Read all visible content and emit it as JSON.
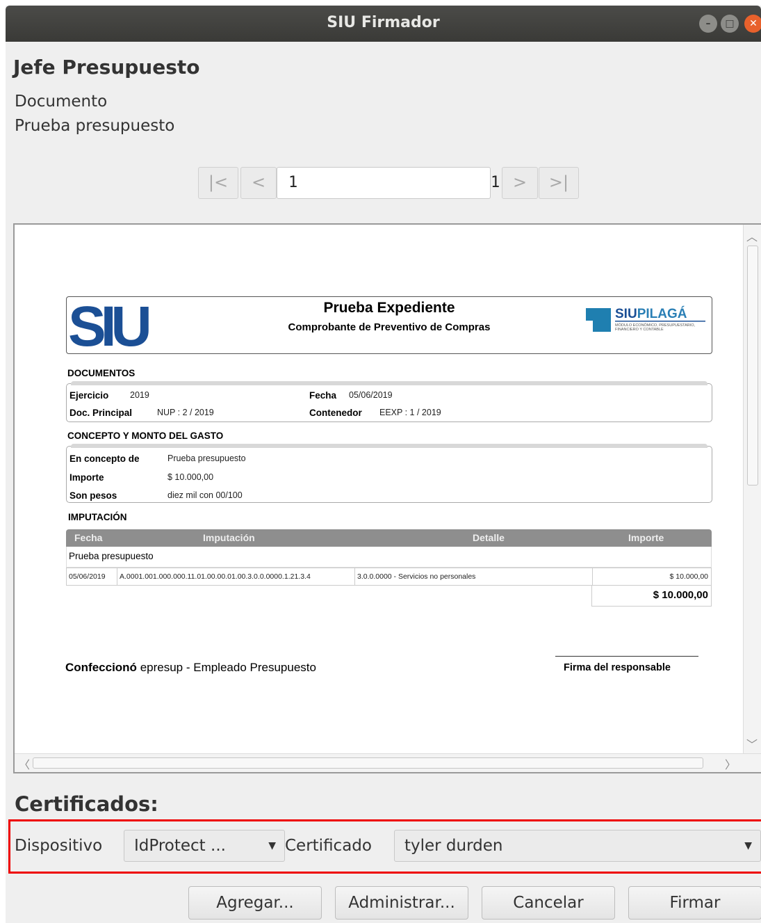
{
  "window": {
    "title": "SIU Firmador",
    "controls": {
      "minimize": "–",
      "maximize": "□",
      "close": "✕"
    }
  },
  "header": {
    "heading": "Jefe Presupuesto",
    "doc_label": "Documento",
    "doc_name": "Prueba presupuesto"
  },
  "pager": {
    "first": "|<",
    "prev": "<",
    "next": ">",
    "last": ">|",
    "current": "1",
    "total": "1"
  },
  "viewer": {
    "scroll_icons": {
      "up": "︿",
      "down": "﹀",
      "left": "〈",
      "right": "〉"
    },
    "logo_left": "SIU",
    "logo_right": {
      "brand_a": "SIU",
      "brand_b": "PILAGÁ",
      "tagline_1": "MÓDULO ECONÓMICO, PRESUPUESTARIO,",
      "tagline_2": "FINANCIERO Y CONTABLE"
    },
    "title": "Prueba Expediente",
    "subtitle": "Comprobante de Preventivo de Compras",
    "documentos": {
      "title": "DOCUMENTOS",
      "ejercicio_label": "Ejercicio",
      "ejercicio": "2019",
      "fecha_label": "Fecha",
      "fecha": "05/06/2019",
      "doc_principal_label": "Doc. Principal",
      "doc_principal": "NUP : 2 / 2019",
      "contenedor_label": "Contenedor",
      "contenedor": "EEXP : 1 / 2019"
    },
    "concepto": {
      "title": "CONCEPTO Y MONTO DEL GASTO",
      "concepto_label": "En concepto de",
      "concepto": "Prueba presupuesto",
      "importe_label": "Importe",
      "importe": "$ 10.000,00",
      "pesos_label": "Son pesos",
      "pesos": "diez mil con 00/100"
    },
    "imputacion": {
      "title": "IMPUTACIÓN",
      "headers": [
        "Fecha",
        "Imputación",
        "Detalle",
        "Importe"
      ],
      "group": "Prueba presupuesto",
      "row": {
        "fecha": "05/06/2019",
        "imputacion": "A.0001.001.000.000.11.01.00.00.01.00.3.0.0.0000.1.21.3.4",
        "detalle": "3.0.0.0000 - Servicios no personales",
        "importe": "$ 10.000,00"
      },
      "total": "$ 10.000,00"
    },
    "confecciono_label": "Confeccionó",
    "confecciono": "epresup - Empleado Presupuesto",
    "firma_label": "Firma del responsable"
  },
  "certificados": {
    "title": "Certificados:",
    "dispositivo_label": "Dispositivo",
    "dispositivo_value": "IdProtect ...",
    "certificado_label": "Certificado",
    "certificado_value": "tyler durden",
    "dropdown_icon": "▼"
  },
  "buttons": {
    "agregar": "Agregar...",
    "administrar": "Administrar...",
    "cancelar": "Cancelar",
    "firmar": "Firmar"
  },
  "colors": {
    "titlebar": "#3c3c3a",
    "highlight": "#ee0000",
    "close": "#e8612c",
    "siu_blue": "#1b4f95"
  }
}
